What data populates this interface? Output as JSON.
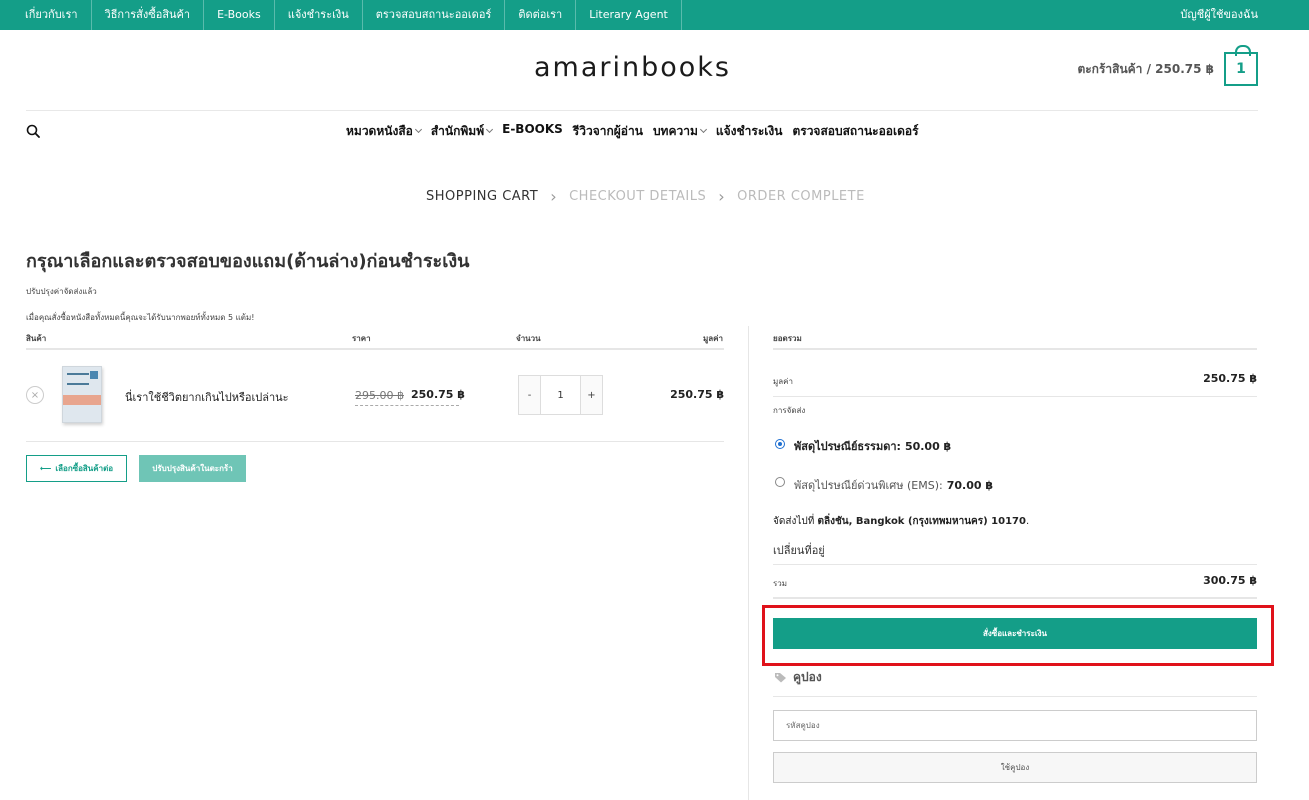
{
  "topbar": {
    "links": [
      "เกี่ยวกับเรา",
      "วิธีการสั่งซื้อสินค้า",
      "E-Books",
      "แจ้งชำระเงิน",
      "ตรวจสอบสถานะออเดอร์",
      "ติดต่อเรา",
      "Literary Agent"
    ],
    "account": "บัญชีผู้ใช้ของฉัน"
  },
  "header": {
    "logo": "amarinbooks",
    "cart_label": "ตะกร้าสินค้า / 250.75 ฿",
    "cart_count": "1"
  },
  "mainnav": {
    "items": [
      "หมวดหนังสือ",
      "สำนักพิมพ์",
      "E-BOOKS",
      "รีวิวจากผู้อ่าน",
      "บทความ",
      "แจ้งชำระเงิน",
      "ตรวจสอบสถานะออเดอร์"
    ]
  },
  "steps": {
    "cart": "SHOPPING CART",
    "checkout": "CHECKOUT DETAILS",
    "complete": "ORDER COMPLETE"
  },
  "page": {
    "title": "กรุณาเลือกและตรวจสอบของแถม(ด้านล่าง)ก่อนชำระเงิน",
    "note_updated": "ปรับปรุงค่าจัดส่งแล้ว",
    "note_gift": "เมื่อคุณสั่งซื้อหนังสือทั้งหมดนี้คุณจะได้รับนากพอยท์ทั้งหมด 5 แต้ม!"
  },
  "cart_table": {
    "headers": {
      "product": "สินค้า",
      "price": "ราคา",
      "qty": "จำนวน",
      "subtotal": "มูลค่า"
    },
    "row": {
      "remove": "×",
      "name": "นี่เราใช้ชีวิตยากเกินไปหรือเปล่านะ",
      "price_old": "295.00 ฿",
      "price_new": "250.75 ฿",
      "qty_minus": "-",
      "qty_value": "1",
      "qty_plus": "+",
      "subtotal": "250.75 ฿"
    },
    "continue_label": "เลือกซื้อสินค้าต่อ",
    "update_label": "ปรับปรุงสินค้าในตะกร้า"
  },
  "totals": {
    "heading": "ยอดรวม",
    "subtotal_label": "มูลค่า",
    "subtotal_value": "250.75 ฿",
    "shipping_label": "การจัดส่ง",
    "options": [
      {
        "label": "พัสดุไปรษณีย์ธรรมดา:",
        "price": "50.00 ฿",
        "selected": true
      },
      {
        "label": "พัสดุไปรษณีย์ด่วนพิเศษ (EMS):",
        "price": "70.00 ฿",
        "selected": false
      }
    ],
    "ship_to_prefix": "จัดส่งไปที่",
    "ship_to_address": "ตลิ่งชัน, Bangkok (กรุงเทพมหานคร) 10170",
    "ship_to_suffix": ".",
    "change_address": "เปลี่ยนที่อยู่",
    "total_label": "รวม",
    "total_value": "300.75 ฿",
    "checkout_label": "สั่งซื้อและชำระเงิน"
  },
  "coupon": {
    "heading": "คูปอง",
    "placeholder": "รหัสคูปอง",
    "apply_label": "ใช้คูปอง"
  },
  "colors": {
    "brand": "#149e88",
    "highlight": "#e0121a"
  }
}
